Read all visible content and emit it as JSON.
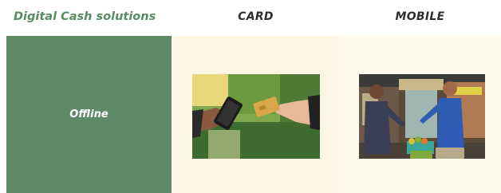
{
  "header": {
    "title": "Digital Cash solutions",
    "card": "CARD",
    "mobile": "MOBILE"
  },
  "offline": {
    "label": "Offline"
  },
  "colors": {
    "green": "#5f8a68",
    "title_green": "#5a8a62",
    "cream": "#fcf5e3",
    "text_dark": "#2e2e2e"
  }
}
